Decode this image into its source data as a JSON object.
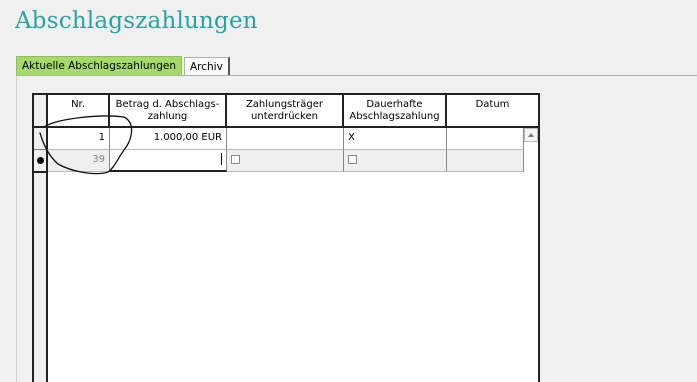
{
  "page": {
    "title": "Abschlagszahlungen"
  },
  "tabs": [
    {
      "label": "Aktuelle Abschlagszahlungen",
      "active": true
    },
    {
      "label": "Archiv",
      "active": false
    }
  ],
  "table": {
    "columns": [
      "Nr.",
      "Betrag d. Abschlags-\nzahlung",
      "Zahlungsträger\nunterdrücken",
      "Dauerhafte\nAbschlagszahlung",
      "Datum"
    ],
    "rows": [
      {
        "nr": "1",
        "betrag": "1.000,00 EUR",
        "zahlungstraeger": "",
        "dauerhaft": "X",
        "datum": ""
      }
    ],
    "new_row": {
      "nr": "39",
      "betrag": "",
      "datum": ""
    }
  },
  "colors": {
    "title": "#27a3a3",
    "active_tab": "#a6d96a"
  },
  "icons": [
    "row-indicator-icon",
    "scroll-up-arrow-icon"
  ]
}
